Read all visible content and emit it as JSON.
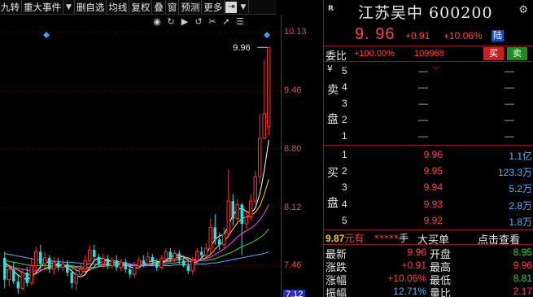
{
  "toolbar": {
    "items": [
      "九转",
      "重大事件",
      "删自选",
      "均线",
      "复权",
      "叠",
      "窗",
      "预测",
      "更多"
    ],
    "arrow": "▼",
    "icons": [
      "export-icon",
      "dropdown-icon"
    ]
  },
  "chart_icons": [
    "eye-icon",
    "redo-icon",
    "play-icon",
    "undo-icon",
    "scissors-icon",
    "pointer-icon",
    "list-icon"
  ],
  "chart_data": {
    "type": "candlestick",
    "y_ticks": [
      "10.13",
      "9.46",
      "8.80",
      "8.12",
      "7.46",
      "7.12"
    ],
    "ylim": [
      7.12,
      10.13
    ],
    "high_label": "9.96",
    "current_label": "7.12",
    "candles": [
      [
        7.55,
        7.3,
        7.62,
        7.2
      ],
      [
        7.3,
        7.42,
        7.48,
        7.22
      ],
      [
        7.42,
        7.28,
        7.5,
        7.25
      ],
      [
        7.28,
        7.2,
        7.36,
        7.14
      ],
      [
        7.2,
        7.38,
        7.42,
        7.18
      ],
      [
        7.38,
        7.26,
        7.45,
        7.22
      ],
      [
        7.26,
        7.46,
        7.55,
        7.24
      ],
      [
        7.46,
        7.62,
        7.68,
        7.4
      ],
      [
        7.62,
        7.48,
        7.7,
        7.42
      ],
      [
        7.48,
        7.55,
        7.62,
        7.44
      ],
      [
        7.55,
        7.42,
        7.58,
        7.38
      ],
      [
        7.42,
        7.5,
        7.56,
        7.36
      ],
      [
        7.5,
        7.44,
        7.55,
        7.4
      ],
      [
        7.44,
        7.48,
        7.54,
        7.4
      ],
      [
        7.48,
        7.38,
        7.52,
        7.34
      ],
      [
        7.38,
        7.26,
        7.42,
        7.2
      ],
      [
        7.26,
        7.36,
        7.4,
        7.18
      ],
      [
        7.36,
        7.42,
        7.48,
        7.32
      ],
      [
        7.42,
        7.52,
        7.58,
        7.4
      ],
      [
        7.52,
        7.64,
        7.7,
        7.48
      ],
      [
        7.64,
        7.56,
        7.7,
        7.5
      ],
      [
        7.56,
        7.48,
        7.6,
        7.44
      ],
      [
        7.48,
        7.54,
        7.6,
        7.44
      ],
      [
        7.54,
        7.46,
        7.58,
        7.42
      ],
      [
        7.46,
        7.52,
        7.56,
        7.42
      ],
      [
        7.52,
        7.44,
        7.58,
        7.4
      ],
      [
        7.44,
        7.5,
        7.54,
        7.4
      ],
      [
        7.5,
        7.42,
        7.54,
        7.38
      ],
      [
        7.42,
        7.36,
        7.48,
        7.32
      ],
      [
        7.36,
        7.46,
        7.5,
        7.32
      ],
      [
        7.46,
        7.52,
        7.56,
        7.42
      ],
      [
        7.52,
        7.48,
        7.58,
        7.44
      ],
      [
        7.48,
        7.56,
        7.62,
        7.46
      ],
      [
        7.56,
        7.5,
        7.6,
        7.46
      ],
      [
        7.5,
        7.44,
        7.54,
        7.4
      ],
      [
        7.44,
        7.54,
        7.58,
        7.42
      ],
      [
        7.54,
        7.62,
        7.66,
        7.5
      ],
      [
        7.62,
        7.54,
        7.66,
        7.5
      ],
      [
        7.54,
        7.6,
        7.64,
        7.5
      ],
      [
        7.6,
        7.52,
        7.64,
        7.48
      ],
      [
        7.52,
        7.46,
        7.58,
        7.44
      ],
      [
        7.46,
        7.4,
        7.5,
        7.36
      ],
      [
        7.4,
        7.52,
        7.56,
        7.36
      ],
      [
        7.52,
        7.62,
        7.66,
        7.48
      ],
      [
        7.62,
        7.58,
        7.68,
        7.54
      ],
      [
        7.58,
        7.66,
        7.72,
        7.54
      ],
      [
        7.66,
        7.9,
        8.0,
        7.6
      ],
      [
        7.9,
        7.76,
        8.05,
        7.7
      ],
      [
        7.76,
        7.7,
        7.84,
        7.64
      ],
      [
        7.7,
        7.82,
        7.9,
        7.66
      ],
      [
        7.82,
        8.2,
        8.56,
        7.78
      ],
      [
        8.2,
        8.0,
        8.28,
        7.92
      ],
      [
        8.0,
        8.16,
        8.22,
        7.96
      ],
      [
        8.16,
        7.94,
        8.18,
        7.58
      ],
      [
        7.94,
        8.02,
        8.08,
        7.88
      ],
      [
        8.02,
        8.2,
        8.28,
        7.98
      ],
      [
        8.2,
        8.48,
        8.54,
        8.16
      ],
      [
        8.48,
        8.92,
        9.2,
        8.4
      ],
      [
        8.92,
        9.2,
        9.82,
        8.9
      ],
      [
        9.05,
        9.96,
        9.96,
        8.95
      ]
    ],
    "ma": [
      {
        "color": "#ffffff",
        "values": [
          7.5,
          7.45,
          7.4,
          7.35,
          7.32,
          7.3,
          7.33,
          7.38,
          7.45,
          7.5,
          7.5,
          7.48,
          7.47,
          7.46,
          7.44,
          7.4,
          7.35,
          7.33,
          7.36,
          7.44,
          7.52,
          7.55,
          7.54,
          7.52,
          7.5,
          7.49,
          7.48,
          7.47,
          7.45,
          7.43,
          7.44,
          7.47,
          7.5,
          7.52,
          7.51,
          7.5,
          7.52,
          7.56,
          7.58,
          7.58,
          7.56,
          7.52,
          7.49,
          7.5,
          7.55,
          7.6,
          7.68,
          7.76,
          7.8,
          7.82,
          7.92,
          8.04,
          8.1,
          8.12,
          8.08,
          8.06,
          8.12,
          8.28,
          8.55,
          8.9
        ]
      },
      {
        "color": "#ffd000",
        "values": [
          7.48,
          7.46,
          7.44,
          7.41,
          7.38,
          7.36,
          7.36,
          7.37,
          7.4,
          7.43,
          7.45,
          7.46,
          7.47,
          7.47,
          7.46,
          7.44,
          7.41,
          7.39,
          7.39,
          7.41,
          7.45,
          7.49,
          7.51,
          7.52,
          7.52,
          7.51,
          7.5,
          7.49,
          7.48,
          7.46,
          7.46,
          7.46,
          7.47,
          7.49,
          7.5,
          7.5,
          7.51,
          7.53,
          7.55,
          7.56,
          7.56,
          7.55,
          7.53,
          7.52,
          7.53,
          7.55,
          7.59,
          7.65,
          7.7,
          7.74,
          7.8,
          7.88,
          7.95,
          8.0,
          8.02,
          8.04,
          8.07,
          8.14,
          8.28,
          8.45
        ]
      },
      {
        "color": "#ff40ff",
        "values": [
          7.45,
          7.45,
          7.44,
          7.43,
          7.42,
          7.41,
          7.4,
          7.4,
          7.41,
          7.42,
          7.43,
          7.44,
          7.45,
          7.46,
          7.46,
          7.45,
          7.44,
          7.43,
          7.42,
          7.42,
          7.43,
          7.45,
          7.47,
          7.48,
          7.49,
          7.49,
          7.49,
          7.49,
          7.48,
          7.47,
          7.47,
          7.47,
          7.47,
          7.48,
          7.48,
          7.49,
          7.5,
          7.51,
          7.52,
          7.53,
          7.54,
          7.54,
          7.53,
          7.53,
          7.53,
          7.54,
          7.56,
          7.59,
          7.62,
          7.65,
          7.69,
          7.74,
          7.79,
          7.83,
          7.86,
          7.89,
          7.93,
          7.98,
          8.06,
          8.16
        ]
      },
      {
        "color": "#30d830",
        "values": [
          7.52,
          7.51,
          7.5,
          7.49,
          7.48,
          7.47,
          7.46,
          7.46,
          7.46,
          7.46,
          7.46,
          7.46,
          7.46,
          7.46,
          7.46,
          7.46,
          7.45,
          7.45,
          7.44,
          7.44,
          7.44,
          7.45,
          7.45,
          7.46,
          7.46,
          7.47,
          7.47,
          7.47,
          7.47,
          7.47,
          7.47,
          7.47,
          7.47,
          7.47,
          7.48,
          7.48,
          7.48,
          7.49,
          7.49,
          7.5,
          7.5,
          7.51,
          7.51,
          7.51,
          7.52,
          7.52,
          7.53,
          7.54,
          7.56,
          7.58,
          7.6,
          7.62,
          7.65,
          7.68,
          7.7,
          7.72,
          7.75,
          7.78,
          7.82,
          7.88
        ]
      },
      {
        "color": "#4fb0ff",
        "values": [
          7.6,
          7.59,
          7.58,
          7.57,
          7.56,
          7.55,
          7.54,
          7.53,
          7.53,
          7.52,
          7.52,
          7.51,
          7.51,
          7.5,
          7.5,
          7.5,
          7.49,
          7.49,
          7.48,
          7.48,
          7.48,
          7.47,
          7.47,
          7.47,
          7.47,
          7.47,
          7.46,
          7.46,
          7.46,
          7.46,
          7.46,
          7.46,
          7.46,
          7.46,
          7.46,
          7.46,
          7.46,
          7.46,
          7.47,
          7.47,
          7.47,
          7.47,
          7.47,
          7.48,
          7.48,
          7.48,
          7.49,
          7.49,
          7.5,
          7.51,
          7.52,
          7.53,
          7.54,
          7.55,
          7.56,
          7.57,
          7.58,
          7.59,
          7.6,
          7.62
        ]
      }
    ]
  },
  "quote": {
    "name": "江苏吴中 600200",
    "r_mark": "R",
    "price": "9. 96",
    "change": "+0.91",
    "change_pct": "+10.06%",
    "exchange_tag": "陆",
    "wb_label": "委比",
    "wb_pct": "+100.00%",
    "wb_diff": "109968",
    "buy_btn": "买",
    "sell_btn": "卖",
    "sell_side_label": [
      "¥",
      "卖",
      "盘"
    ],
    "buy_side_label": [
      "买",
      "盘"
    ],
    "asks": [
      {
        "level": "5",
        "price": "—",
        "vol": "—"
      },
      {
        "level": "4",
        "price": "—",
        "vol": "—"
      },
      {
        "level": "3",
        "price": "—",
        "vol": "—"
      },
      {
        "level": "2",
        "price": "—",
        "vol": "—"
      },
      {
        "level": "1",
        "price": "—",
        "vol": "—"
      }
    ],
    "bids": [
      {
        "level": "1",
        "price": "9.96",
        "vol": "1.1亿"
      },
      {
        "level": "2",
        "price": "9.95",
        "vol": "123.3万"
      },
      {
        "level": "3",
        "price": "9.94",
        "vol": "5.2万"
      },
      {
        "level": "4",
        "price": "9.93",
        "vol": "2.8万"
      },
      {
        "level": "5",
        "price": "9.92",
        "vol": "1.8万"
      }
    ],
    "big_price_num": "9.87",
    "big_price_unit": "元有",
    "big_stars": "*****",
    "big_stars_unit": "手",
    "big_text": "大买单",
    "big_link": "点击查看",
    "stats": [
      {
        "l": "最新",
        "v": "9.96",
        "vc": "red",
        "l2": "开盘",
        "v2": "8.95",
        "v2c": "green"
      },
      {
        "l": "涨跌",
        "v": "+0.91",
        "vc": "red",
        "l2": "最高",
        "v2": "9.96",
        "v2c": "red"
      },
      {
        "l": "涨幅",
        "v": "+10.06%",
        "vc": "red",
        "l2": "最低",
        "v2": "8.81",
        "v2c": "green"
      },
      {
        "l": "振幅",
        "v": "12.71%",
        "vc": "cyan",
        "l2": "量比",
        "v2": "2.17",
        "v2c": "red"
      }
    ]
  }
}
